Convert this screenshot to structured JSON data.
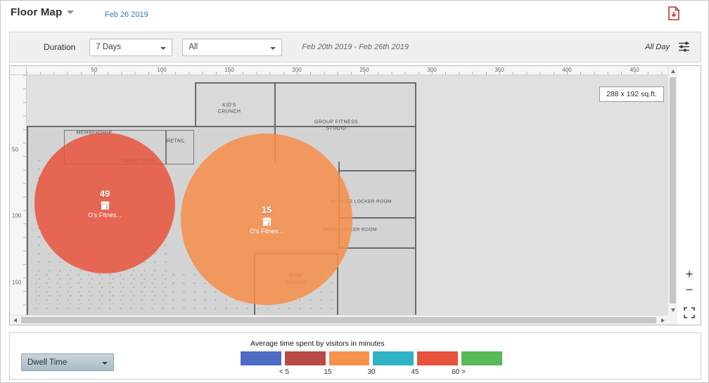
{
  "header": {
    "title": "Floor Map",
    "date": "Feb 26 2019",
    "date_color": "#2a7db3"
  },
  "toolbar": {
    "duration_label": "Duration",
    "duration_value": "7 Days",
    "area_value": "All",
    "date_range": "Feb 20th 2019 - Feb 26th 2019",
    "time_filter": "All Day"
  },
  "map": {
    "size_label": "288 x 192 sq.ft.",
    "ruler_x": [
      "50",
      "100",
      "150",
      "200",
      "250",
      "300",
      "350",
      "400",
      "450"
    ],
    "ruler_y": [
      "50",
      "100",
      "150"
    ],
    "rooms": [
      {
        "label": "MEMBERSHIP"
      },
      {
        "label": "RETAIL"
      },
      {
        "label": "FRONT DESK"
      },
      {
        "label": "KID'S CRUNCH"
      },
      {
        "label": "GROUP FITNESS STUDIO"
      },
      {
        "label": "WOMENS LOCKER ROOM"
      },
      {
        "label": "MENS LOCKER ROOM"
      },
      {
        "label": "RIDE STUDIO"
      }
    ],
    "bubbles": [
      {
        "value": "49",
        "label": "O's Fitnes...",
        "color": "#e8543c"
      },
      {
        "value": "15",
        "label": "O's Fitnes...",
        "color": "#f68e4a"
      }
    ],
    "controls": {
      "zoom_in": "+",
      "zoom_out": "−"
    }
  },
  "legend": {
    "metric": "Dwell Time",
    "title": "Average time spent by visitors in minutes",
    "swatches": [
      {
        "color": "#4d6cc3"
      },
      {
        "color": "#b94b46"
      },
      {
        "color": "#f6914e"
      },
      {
        "color": "#2eb3c5"
      },
      {
        "color": "#e8523c"
      },
      {
        "color": "#58b957"
      }
    ],
    "labels": [
      "< 5",
      "15",
      "30",
      "45",
      "60 >"
    ]
  }
}
